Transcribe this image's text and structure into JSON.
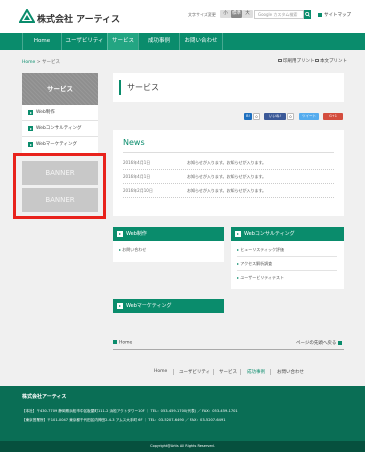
{
  "header": {
    "company": "株式会社 アーティス",
    "font_size_label": "文字サイズ変更",
    "font_sizes": [
      "小",
      "標準",
      "大"
    ],
    "search_placeholder": "Google カスタム検索",
    "sitemap": "サイトマップ"
  },
  "nav": [
    "Home",
    "ユーザビリティ",
    "サービス",
    "成功事例",
    "お問い合わせ"
  ],
  "breadcrumb": {
    "home": "Home",
    "sep": ">",
    "current": "サービス"
  },
  "utility": {
    "print": "印刷用プリント",
    "text_print": "本文プリント"
  },
  "sidebar": {
    "title": "サービス",
    "items": [
      "Web制作",
      "Webコンサルティング",
      "Webマーケティング"
    ],
    "banners": [
      "BANNER",
      "BANNER"
    ]
  },
  "page_title": "サービス",
  "social": {
    "share1": "B!",
    "share2": "0",
    "like": "いいね!",
    "count": "0",
    "tweet": "ツイート",
    "gplus": "G+1"
  },
  "news": {
    "title": "News",
    "items": [
      {
        "date": "2016年4月1日",
        "text": "お知らせが入ります。お知らせが入ります。"
      },
      {
        "date": "2016年4月1日",
        "text": "お知らせが入ります。お知らせが入ります。"
      },
      {
        "date": "2016年2月10日",
        "text": "お知らせが入ります。お知らせが入ります。"
      }
    ]
  },
  "boxes": {
    "web_production": {
      "title": "Web制作",
      "links": [
        "お問い合わせ"
      ]
    },
    "web_consulting": {
      "title": "Webコンサルティング",
      "links": [
        "ヒューリスティック評価",
        "アクセス解析調査",
        "ユーザービリティテスト"
      ]
    },
    "web_marketing": {
      "title": "Webマーケティング"
    }
  },
  "pager": {
    "home": "Home",
    "top": "ページの先頭へ戻る"
  },
  "footer_nav": [
    "Home",
    "ユーザビリティ",
    "サービス",
    "成功事例",
    "お問い合わせ"
  ],
  "footer": {
    "company": "株式会社アーティス",
    "addr1": "【本社】〒430-7709 静岡県浜松市中区板屋町111-2 浜松アクトタワー10F ｜ TEL：053-459-1700(代表) ／ FAX：053-459-1701",
    "addr2": "【東京営業所】〒101-0047 東京都千代田区内神田2-4-3 アムス大手町 6F ｜ TEL：03-5207-6490 ／ FAX：03-5207-6491",
    "copyright": "Copyright@Artis All Rights Reserved."
  },
  "colors": {
    "brand": "#0a8c6c",
    "footer": "#0a6e55",
    "highlight": "#e8221c"
  }
}
